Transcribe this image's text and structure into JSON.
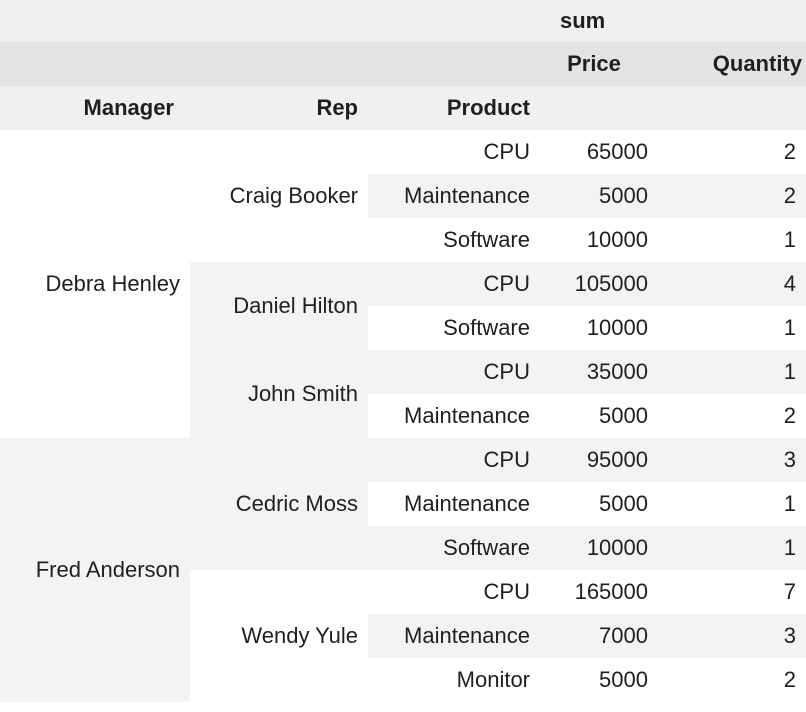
{
  "header": {
    "aggregate_label": "sum",
    "value_columns": [
      "Price",
      "Quantity"
    ],
    "index_columns": [
      "Manager",
      "Rep",
      "Product"
    ]
  },
  "managers": [
    {
      "name": "Debra Henley",
      "reps": [
        {
          "name": "Craig Booker",
          "rows": [
            {
              "product": "CPU",
              "price": "65000",
              "quantity": "2"
            },
            {
              "product": "Maintenance",
              "price": "5000",
              "quantity": "2"
            },
            {
              "product": "Software",
              "price": "10000",
              "quantity": "1"
            }
          ]
        },
        {
          "name": "Daniel Hilton",
          "rows": [
            {
              "product": "CPU",
              "price": "105000",
              "quantity": "4"
            },
            {
              "product": "Software",
              "price": "10000",
              "quantity": "1"
            }
          ]
        },
        {
          "name": "John Smith",
          "rows": [
            {
              "product": "CPU",
              "price": "35000",
              "quantity": "1"
            },
            {
              "product": "Maintenance",
              "price": "5000",
              "quantity": "2"
            }
          ]
        }
      ]
    },
    {
      "name": "Fred Anderson",
      "reps": [
        {
          "name": "Cedric Moss",
          "rows": [
            {
              "product": "CPU",
              "price": "95000",
              "quantity": "3"
            },
            {
              "product": "Maintenance",
              "price": "5000",
              "quantity": "1"
            },
            {
              "product": "Software",
              "price": "10000",
              "quantity": "1"
            }
          ]
        },
        {
          "name": "Wendy Yule",
          "rows": [
            {
              "product": "CPU",
              "price": "165000",
              "quantity": "7"
            },
            {
              "product": "Maintenance",
              "price": "7000",
              "quantity": "3"
            },
            {
              "product": "Monitor",
              "price": "5000",
              "quantity": "2"
            }
          ]
        }
      ]
    }
  ]
}
